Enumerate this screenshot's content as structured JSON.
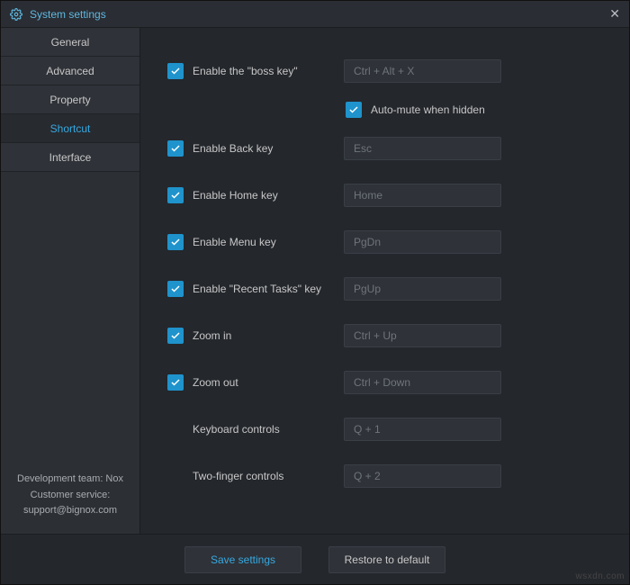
{
  "titlebar": {
    "title": "System settings"
  },
  "sidebar": {
    "tabs": [
      {
        "label": "General",
        "active": false
      },
      {
        "label": "Advanced",
        "active": false
      },
      {
        "label": "Property",
        "active": false
      },
      {
        "label": "Shortcut",
        "active": true
      },
      {
        "label": "Interface",
        "active": false
      }
    ],
    "footer": {
      "line1": "Development team: Nox",
      "line2": "Customer service:",
      "line3": "support@bignox.com"
    }
  },
  "rows": {
    "bosskey": {
      "checked": true,
      "label": "Enable the \"boss key\"",
      "key": "Ctrl + Alt + X"
    },
    "automute": {
      "checked": true,
      "label": "Auto-mute when hidden"
    },
    "back": {
      "checked": true,
      "label": "Enable Back key",
      "key": "Esc"
    },
    "home": {
      "checked": true,
      "label": "Enable Home key",
      "key": "Home"
    },
    "menu": {
      "checked": true,
      "label": "Enable Menu key",
      "key": "PgDn"
    },
    "recent": {
      "checked": true,
      "label": "Enable \"Recent Tasks\" key",
      "key": "PgUp"
    },
    "zoomin": {
      "checked": true,
      "label": "Zoom in",
      "key": "Ctrl + Up"
    },
    "zoomout": {
      "checked": true,
      "label": "Zoom out",
      "key": "Ctrl + Down"
    },
    "keyboard": {
      "checked": null,
      "label": "Keyboard controls",
      "key": "Q + 1"
    },
    "twofinger": {
      "checked": null,
      "label": "Two-finger controls",
      "key": "Q + 2"
    }
  },
  "footer": {
    "save": "Save settings",
    "restore": "Restore to default"
  },
  "watermark": "wsxdn.com"
}
